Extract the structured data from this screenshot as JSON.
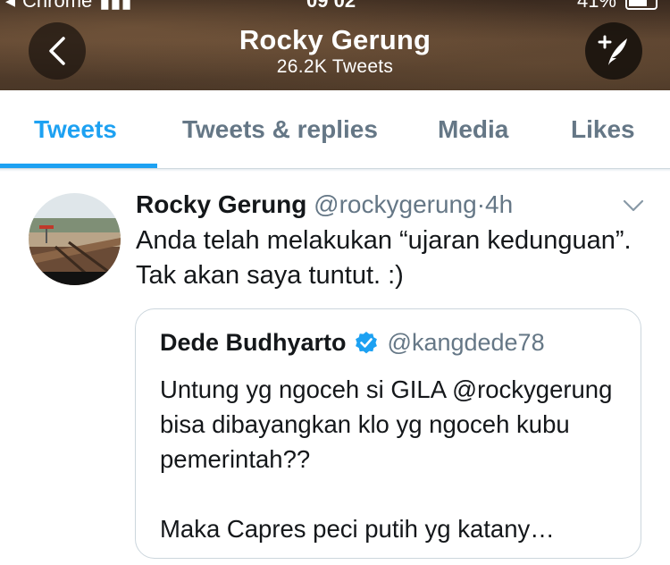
{
  "status_bar": {
    "carrier": "Chrome",
    "time": "09 02",
    "battery": "41%"
  },
  "header": {
    "title": "Rocky Gerung",
    "subtitle": "26.2K Tweets",
    "back_icon": "chevron-left-icon",
    "compose_icon": "compose-tweet-icon"
  },
  "tabs": [
    {
      "label": "Tweets",
      "active": true
    },
    {
      "label": "Tweets & replies",
      "active": false
    },
    {
      "label": "Media",
      "active": false
    },
    {
      "label": "Likes",
      "active": false
    }
  ],
  "tweet": {
    "name": "Rocky Gerung",
    "handle": "@rockygerung",
    "separator": "·",
    "time": "4h",
    "text": "Anda telah melakukan “ujaran kedunguan”. Tak akan saya tuntut. :)",
    "quoted": {
      "name": "Dede Budhyarto",
      "verified": true,
      "handle": "@kangdede78",
      "text": "Untung yg ngoceh si GILA @rockygerung bisa dibayangkan klo yg ngoceh kubu pemerintah??\n\nMaka Capres peci putih yg katany…"
    }
  },
  "colors": {
    "accent": "#1da1f2",
    "secondary_text": "#657786",
    "primary_text": "#14171a",
    "border": "#ccd6dd"
  }
}
